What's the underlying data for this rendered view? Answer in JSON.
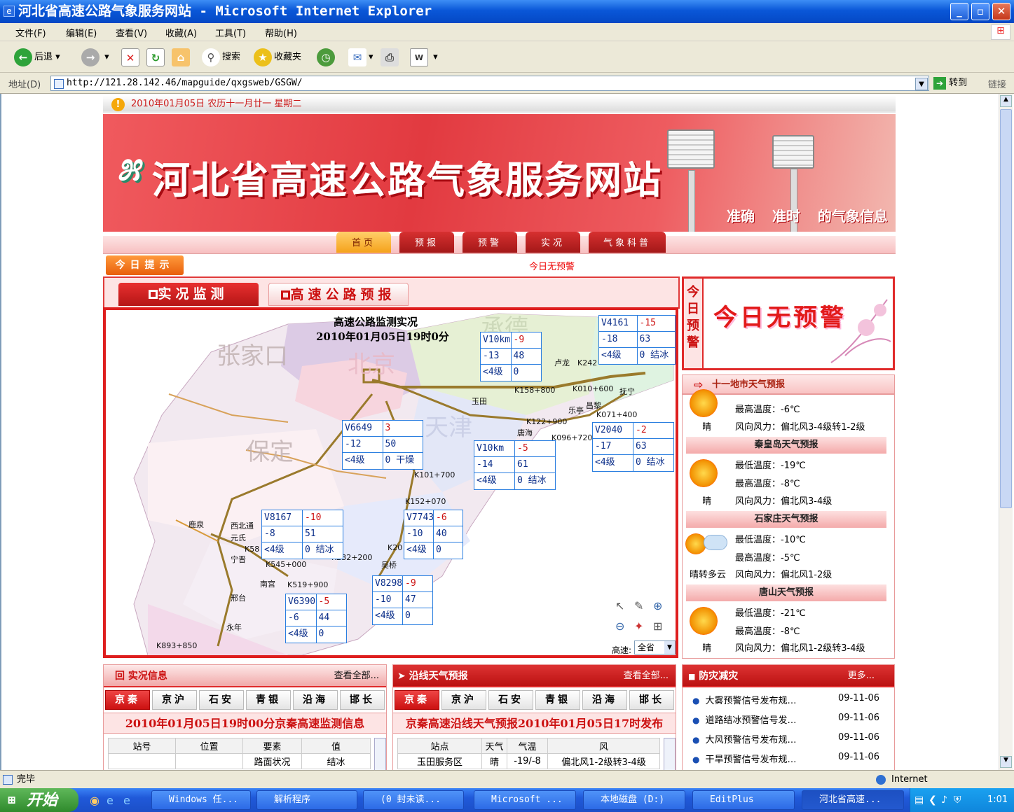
{
  "window": {
    "title": "河北省高速公路气象服务网站 - Microsoft Internet Explorer"
  },
  "menu": [
    "文件(F)",
    "编辑(E)",
    "查看(V)",
    "收藏(A)",
    "工具(T)",
    "帮助(H)"
  ],
  "toolbar": {
    "back": "后退",
    "search": "搜索",
    "favorites": "收藏夹"
  },
  "address": {
    "label": "地址(D)",
    "url": "http://121.28.142.46/mapguide/qxgsweb/GSGW/",
    "go": "转到",
    "links": "链接"
  },
  "page": {
    "date": "2010年01月05日 农历十一月廿一 星期二",
    "banner_title": "河北省高速公路气象服务网站",
    "banner_slogan": "准确 准时 的气象信息",
    "nav": [
      "首页",
      "预报",
      "预警",
      "实况",
      "气象科普"
    ],
    "tip_label": "今日提示",
    "tip_text": "今日无预警",
    "tabs": [
      "实况监测",
      "高速公路预报"
    ],
    "map": {
      "title": "高速公路监测实况",
      "time": "2010年01月05日19时0分",
      "cities": [
        "张家口",
        "北京",
        "承德",
        "天津",
        "保定"
      ],
      "labels": [
        "卢龙",
        "K242",
        "K158+800",
        "K010+600",
        "抚宁",
        "玉田",
        "乐亭",
        "昌黎",
        "K071+400",
        "K122+900",
        "唐海",
        "K096+720",
        "K101+700",
        "K152+070",
        "鹿泉",
        "西北通",
        "元氏",
        "K58",
        "宁晋",
        "K545+000",
        "K232+200",
        "K20",
        "吴桥",
        "南宫",
        "K519+900",
        "邢台",
        "永年",
        "K893+850"
      ],
      "stations": [
        {
          "r1": [
            "V4161",
            "-15"
          ],
          "r2": [
            "-18",
            "63"
          ],
          "r3": [
            "<4级",
            "0 结冰"
          ]
        },
        {
          "r1": [
            "V10km",
            "-9"
          ],
          "r2": [
            "-13",
            "48"
          ],
          "r3": [
            "<4级",
            "0"
          ]
        },
        {
          "r1": [
            "V6649",
            "3"
          ],
          "r2": [
            "-12",
            "50"
          ],
          "r3": [
            "<4级",
            "0 干燥"
          ]
        },
        {
          "r1": [
            "V10km",
            "-5"
          ],
          "r2": [
            "-14",
            "61"
          ],
          "r3": [
            "<4级",
            "0 结冰"
          ]
        },
        {
          "r1": [
            "V2040",
            "-2"
          ],
          "r2": [
            "-17",
            "63"
          ],
          "r3": [
            "<4级",
            "0 结冰"
          ]
        },
        {
          "r1": [
            "V8167",
            "-10"
          ],
          "r2": [
            "-8",
            "51"
          ],
          "r3": [
            "<4级",
            "0 结冰"
          ]
        },
        {
          "r1": [
            "V7743",
            "-6"
          ],
          "r2": [
            "-10",
            "40"
          ],
          "r3": [
            "<4级",
            "0"
          ]
        },
        {
          "r1": [
            "V8298",
            "-9"
          ],
          "r2": [
            "-10",
            "47"
          ],
          "r3": [
            "<4级",
            "0"
          ]
        },
        {
          "r1": [
            "V6390",
            "-5"
          ],
          "r2": [
            "-6",
            "44"
          ],
          "r3": [
            "<4级",
            "0"
          ]
        }
      ],
      "road_label": "高速:",
      "road_select": "全省"
    },
    "warn": {
      "vertical": "今日预警",
      "title": "今日无预警"
    },
    "city_header": "十一地市天气预报",
    "cities_forecast": [
      {
        "name": "",
        "low": "",
        "high": "最高温度：-6℃",
        "sky": "晴",
        "wind": "风向风力：偏北风3-4级转1-2级"
      },
      {
        "name": "秦皇岛天气预报",
        "low": "最低温度：-19℃",
        "high": "最高温度：-8℃",
        "sky": "晴",
        "wind": "风向风力：偏北风3-4级"
      },
      {
        "name": "石家庄天气预报",
        "low": "最低温度：-10℃",
        "high": "最高温度：-5℃",
        "sky": "晴转多云",
        "wind": "风向风力：偏北风1-2级"
      },
      {
        "name": "唐山天气预报",
        "low": "最低温度：-21℃",
        "high": "最高温度：-8℃",
        "sky": "晴",
        "wind": "风向风力：偏北风1-2级转3-4级"
      }
    ],
    "live": {
      "title": "实况信息",
      "more": "查看全部...",
      "tabs": [
        "京秦",
        "京沪",
        "石安",
        "青银",
        "沿海",
        "邯长"
      ],
      "caption": "2010年01月05日19时00分京秦高速监测信息",
      "cols": [
        "站号",
        "位置",
        "要素",
        "值"
      ],
      "row": [
        "",
        "",
        "路面状况",
        "结冰"
      ]
    },
    "along": {
      "title": "沿线天气预报",
      "more": "查看全部...",
      "tabs": [
        "京秦",
        "京沪",
        "石安",
        "青银",
        "沿海",
        "邯长"
      ],
      "caption": "京秦高速沿线天气预报2010年01月05日17时发布",
      "cols": [
        "站点",
        "天气",
        "气温",
        "风"
      ],
      "row": [
        "玉田服务区",
        "晴",
        "-19/-8",
        "偏北风1-2级转3-4级"
      ]
    },
    "disaster": {
      "title": "防灾减灾",
      "more": "更多...",
      "items": [
        {
          "text": "大雾预警信号发布规…",
          "date": "09-11-06"
        },
        {
          "text": "道路结冰预警信号发…",
          "date": "09-11-06"
        },
        {
          "text": "大风预警信号发布规…",
          "date": "09-11-06"
        },
        {
          "text": "干旱预警信号发布规…",
          "date": "09-11-06"
        }
      ]
    }
  },
  "status": {
    "left": "完毕",
    "zone": "Internet"
  },
  "taskbar": {
    "start": "开始",
    "tasks": [
      "Windows 任...",
      "解析程序",
      "(0 封未读...",
      "Microsoft ...",
      "本地磁盘 (D:)",
      "EditPlus",
      "河北省高速..."
    ],
    "clock": "1:01"
  },
  "colors": {
    "brand_red": "#e02a2a",
    "xp_blue": "#0a57d8"
  }
}
